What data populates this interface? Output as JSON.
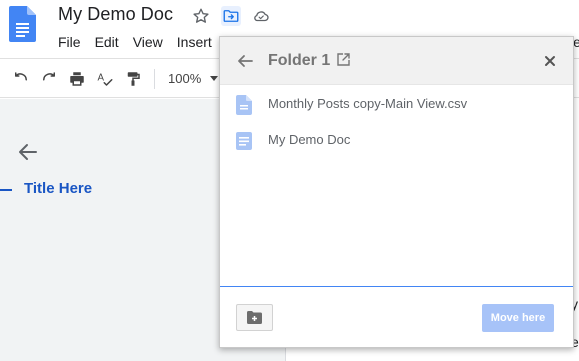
{
  "doc": {
    "title": "My Demo Doc"
  },
  "menubar": {
    "items": [
      "File",
      "Edit",
      "View",
      "Insert"
    ],
    "cut_item": "Help"
  },
  "toolbar": {
    "zoom": "100%",
    "icons": [
      "undo-icon",
      "redo-icon",
      "print-icon",
      "spellcheck-icon",
      "paint-format-icon"
    ]
  },
  "outline": {
    "title": "Title Here"
  },
  "page_peek": {
    "line1": "y",
    "line2": "e"
  },
  "move_dialog": {
    "folder_name": "Folder 1",
    "files": [
      {
        "name": "Monthly Posts copy-Main View.csv",
        "icon": "document-icon"
      },
      {
        "name": "My Demo Doc",
        "icon": "doc-file-icon"
      }
    ],
    "move_button_label": "Move here"
  },
  "colors": {
    "accent": "#4285f4",
    "doc_blue": "#4285f4",
    "outline_title": "#1a56c4",
    "move_button_disabled": "#a7c3f8"
  }
}
